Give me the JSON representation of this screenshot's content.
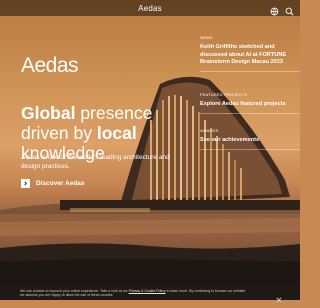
{
  "header": {
    "brand": "Aedas"
  },
  "hero": {
    "logo": "Aedas",
    "headline_bold_1": "Global",
    "headline_rest_1": " presence driven by ",
    "headline_bold_2": "local",
    "headline_rest_2": " knowledge",
    "description": "Aedas is one of the world's leading architecture and design practices.",
    "cta_label": "Discover Aedas"
  },
  "sidebar": {
    "sections": [
      {
        "tag": "NEWS",
        "link": "Keith Griffiths sketched and discussed about AI at FORTUNE Brainstorm Design Macau 2023"
      },
      {
        "tag": "FEATURED PROJECTS",
        "link": "Explore Aedas featured projects"
      },
      {
        "tag": "AWARDS",
        "link": "See our achievements"
      }
    ]
  },
  "cookie": {
    "text_before": "We use cookies to improve your online experience. Take a look at our ",
    "policy_link": "Privacy & Cookie Policy",
    "text_after": " to learn more. By continuing to browse our website we assume you are happy to allow the use of these cookies."
  },
  "icons": {
    "search": "search-icon",
    "language": "globe-icon",
    "cta_arrow": "chevron-right-icon",
    "close": "close-icon"
  }
}
